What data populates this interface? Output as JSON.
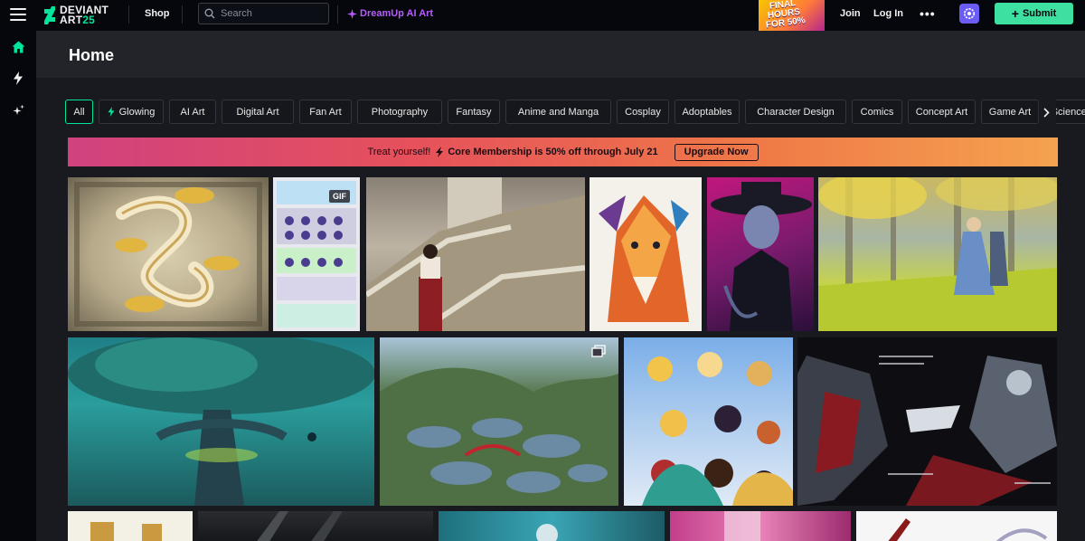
{
  "header": {
    "logo_line1": "DEVIANT",
    "logo_line2": "ART",
    "logo_suffix": "25",
    "shop_label": "Shop",
    "search_placeholder": "Search",
    "dreamup_label": "DreamUp AI Art",
    "promo_line1": "FINAL",
    "promo_line2": "HOURS",
    "promo_line3": "FOR 50%",
    "join_label": "Join",
    "login_label": "Log In",
    "more_label": "•••",
    "submit_label": "Submit"
  },
  "rail": {
    "items": [
      "home-icon",
      "bolt-icon",
      "dreamup-icon"
    ],
    "accent": "#00e59b"
  },
  "page": {
    "title": "Home"
  },
  "chips": [
    {
      "label": "All",
      "active": true
    },
    {
      "label": "Glowing"
    },
    {
      "label": "AI Art"
    },
    {
      "label": "Digital Art"
    },
    {
      "label": "Fan Art"
    },
    {
      "label": "Photography"
    },
    {
      "label": "Fantasy"
    },
    {
      "label": "Anime and Manga"
    },
    {
      "label": "Cosplay"
    },
    {
      "label": "Adoptables"
    },
    {
      "label": "Character Design"
    },
    {
      "label": "Comics"
    },
    {
      "label": "Concept Art"
    },
    {
      "label": "Game Art"
    },
    {
      "label": "Science Fiction"
    }
  ],
  "banner": {
    "treat": "Treat yourself!",
    "membership": "Core Membership is 50% off through July 21",
    "cta": "Upgrade Now"
  },
  "thumbnails": {
    "gif_badge": "GIF"
  },
  "colors": {
    "accent": "#00e59b",
    "submit_bg": "#3ee0a2",
    "dreamup": "#b65cff",
    "page_bg": "#191a1f"
  }
}
